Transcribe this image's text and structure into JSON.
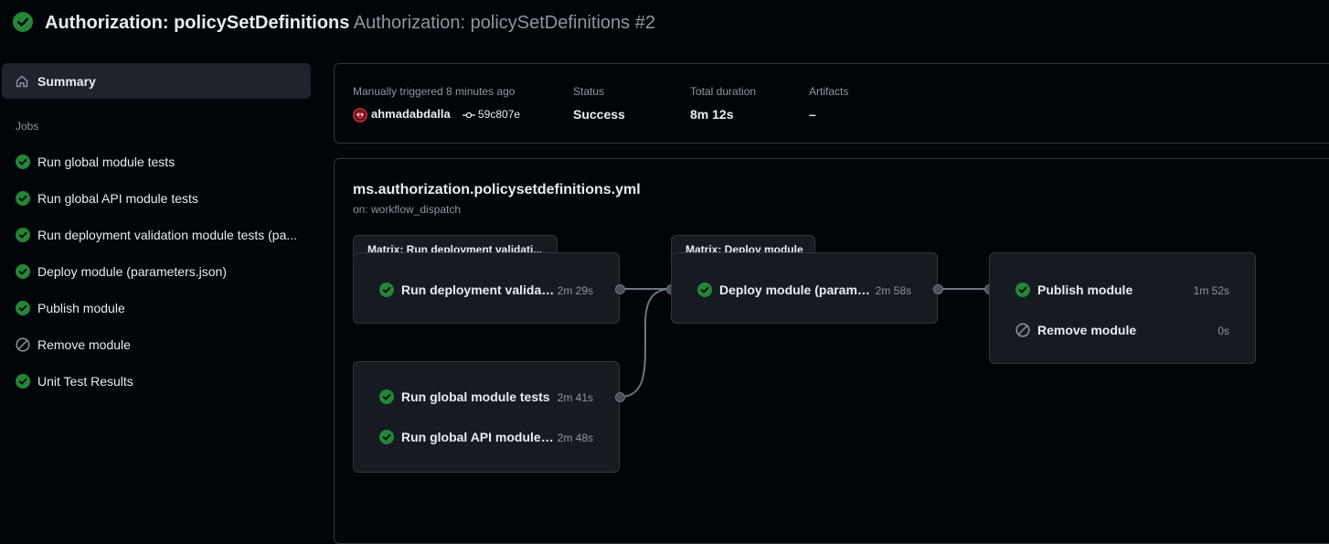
{
  "header": {
    "title": "Authorization: policySetDefinitions",
    "subtitle": "Authorization: policySetDefinitions #2",
    "status_icon": "check-circle-fill-icon",
    "colors": {
      "success": "#238636",
      "muted": "#8d96a0",
      "background": "#010409",
      "panel": "#161b22",
      "border": "#30363d"
    }
  },
  "sidebar": {
    "summary_label": "Summary",
    "summary_icon": "home-icon",
    "jobs_heading": "Jobs",
    "jobs": [
      {
        "label": "Run global module tests",
        "status": "success"
      },
      {
        "label": "Run global API module tests",
        "status": "success"
      },
      {
        "label": "Run deployment validation module tests (pa...",
        "status": "success"
      },
      {
        "label": "Deploy module (parameters.json)",
        "status": "success"
      },
      {
        "label": "Publish module",
        "status": "success"
      },
      {
        "label": "Remove module",
        "status": "skipped"
      },
      {
        "label": "Unit Test Results",
        "status": "success"
      }
    ]
  },
  "run_summary": {
    "trigger_label": "Manually triggered 8 minutes ago",
    "actor": "ahmadabdalla",
    "commit": "59c807e",
    "status_label": "Status",
    "status_value": "Success",
    "duration_label": "Total duration",
    "duration_value": "8m 12s",
    "artifacts_label": "Artifacts",
    "artifacts_value": "–"
  },
  "workflow": {
    "file": "ms.authorization.policysetdefinitions.yml",
    "trigger": "on: workflow_dispatch",
    "matrix_validation": {
      "tab": "Matrix: Run deployment validati...",
      "job": "Run deployment validati...",
      "duration": "2m 29s"
    },
    "global_tests": [
      {
        "job": "Run global module tests",
        "duration": "2m 41s"
      },
      {
        "job": "Run global API module t...",
        "duration": "2m 48s"
      }
    ],
    "matrix_deploy": {
      "tab": "Matrix: Deploy module",
      "job": "Deploy module (parame...",
      "duration": "2m 58s"
    },
    "publish_group": [
      {
        "job": "Publish module",
        "duration": "1m 52s",
        "status": "success"
      },
      {
        "job": "Remove module",
        "duration": "0s",
        "status": "skipped"
      }
    ]
  }
}
